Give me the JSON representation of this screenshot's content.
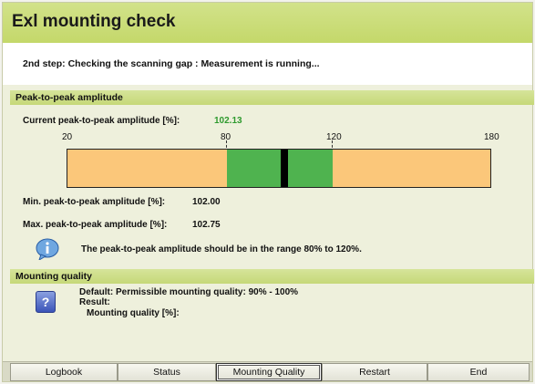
{
  "window": {
    "title": "Exl mounting check",
    "step_text": "2nd step: Checking the scanning gap : Measurement is running..."
  },
  "amplitude": {
    "header": "Peak-to-peak amplitude",
    "current_label": "Current peak-to-peak amplitude [%]:",
    "current_value": "102.13",
    "scale_ticks": [
      "20",
      "80",
      "120",
      "180"
    ],
    "scale_range": [
      20,
      180
    ],
    "green_range": [
      80,
      120
    ],
    "marker_value": 102.13,
    "min_label": "Min. peak-to-peak amplitude [%]:",
    "min_value": "102.00",
    "max_label": "Max. peak-to-peak amplitude [%]:",
    "max_value": "102.75",
    "info_text": "The peak-to-peak amplitude should be in the range 80% to 120%.",
    "colors": {
      "out_of_range": "#fbc77a",
      "in_range": "#4fb34f",
      "marker": "#000000",
      "value_text": "#2e9a2e"
    }
  },
  "mounting_quality": {
    "header": "Mounting quality",
    "default_text": "Default: Permissible mounting quality: 90% - 100%",
    "result_label": "Result:",
    "quality_label": "Mounting quality [%]:",
    "quality_value": ""
  },
  "buttons": {
    "logbook": "Logbook",
    "status": "Status",
    "mounting_quality": "Mounting Quality",
    "restart": "Restart",
    "end": "End"
  },
  "theme": {
    "title_bar": "#c8dc74",
    "panel": "#eef0dc"
  }
}
